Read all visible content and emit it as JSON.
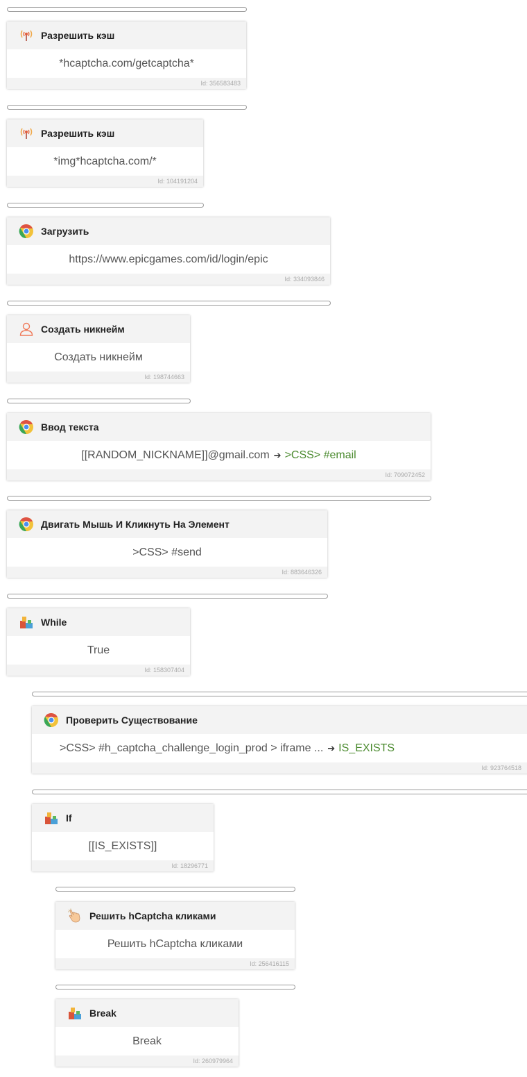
{
  "blocks": [
    {
      "title": "Разрешить кэш",
      "icon": "antenna-icon",
      "body": "*hcaptcha.com/getcaptcha*",
      "id": "Id: 356583483"
    },
    {
      "title": "Разрешить кэш",
      "icon": "antenna-icon",
      "body": "*img*hcaptcha.com/*",
      "id": "Id: 104191204"
    },
    {
      "title": "Загрузить",
      "icon": "chrome-icon",
      "body": "https://www.epicgames.com/id/login/epic",
      "id": "Id: 334093846"
    },
    {
      "title": "Создать никнейм",
      "icon": "user-icon",
      "body": "Создать никнейм",
      "id": "Id: 198744663"
    },
    {
      "title": "Ввод текста",
      "icon": "chrome-icon",
      "body": "[[RANDOM_NICKNAME]]@gmail.com",
      "target": ">CSS> #email",
      "id": "Id: 709072452"
    },
    {
      "title": "Двигать Мышь И Кликнуть На Элемент",
      "icon": "chrome-icon",
      "body": ">CSS> #send",
      "id": "Id: 883646326"
    },
    {
      "title": "While",
      "icon": "puzzle-icon",
      "body": "True",
      "id": "Id: 158307404"
    },
    {
      "title": "Проверить Существование",
      "icon": "chrome-icon",
      "body": ">CSS> #h_captcha_challenge_login_prod > iframe ...",
      "target": "IS_EXISTS",
      "id": "Id: 923764518"
    },
    {
      "title": "If",
      "icon": "puzzle-icon",
      "body": "[[IS_EXISTS]]",
      "id": "Id: 18296771"
    },
    {
      "title": "Решить hCaptcha кликами",
      "icon": "hand-pointer-icon",
      "body": "Решить hCaptcha кликами",
      "id": "Id: 256416115"
    },
    {
      "title": "Break",
      "icon": "puzzle-icon",
      "body": "Break",
      "id": "Id: 260979964"
    }
  ],
  "colors": {
    "accent_text": "#4a8a2e",
    "header_bg": "#f3f3f3",
    "footer_text": "#aaaaaa",
    "separator_border": "#9a9a9a"
  }
}
